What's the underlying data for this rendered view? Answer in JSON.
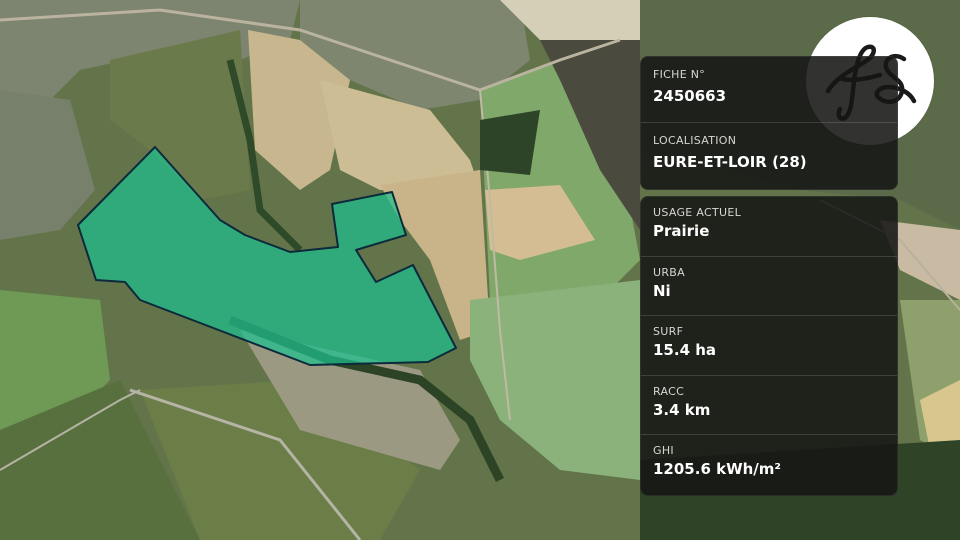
{
  "colors": {
    "parcel_fill": "#1fbf8f",
    "parcel_stroke": "#0b2a3b",
    "panel_bg": "#161614",
    "logo_bg": "#ffffff",
    "logo_ink": "#1a1a1a"
  },
  "logo": {
    "icon": "fs-monogram-icon",
    "text": "fs"
  },
  "fiche": {
    "label": "FICHE N°",
    "value": "2450663"
  },
  "localisation": {
    "label": "LOCALISATION",
    "value": "EURE-ET-LOIR (28)"
  },
  "fields": [
    {
      "label": "USAGE ACTUEL",
      "value": "Prairie"
    },
    {
      "label": "URBA",
      "value": "Ni"
    },
    {
      "label": "SURF",
      "value": "15.4 ha"
    },
    {
      "label": "RACC",
      "value": "3.4 km"
    },
    {
      "label": "GHI",
      "value": "1205.6 kWh/m²"
    }
  ]
}
